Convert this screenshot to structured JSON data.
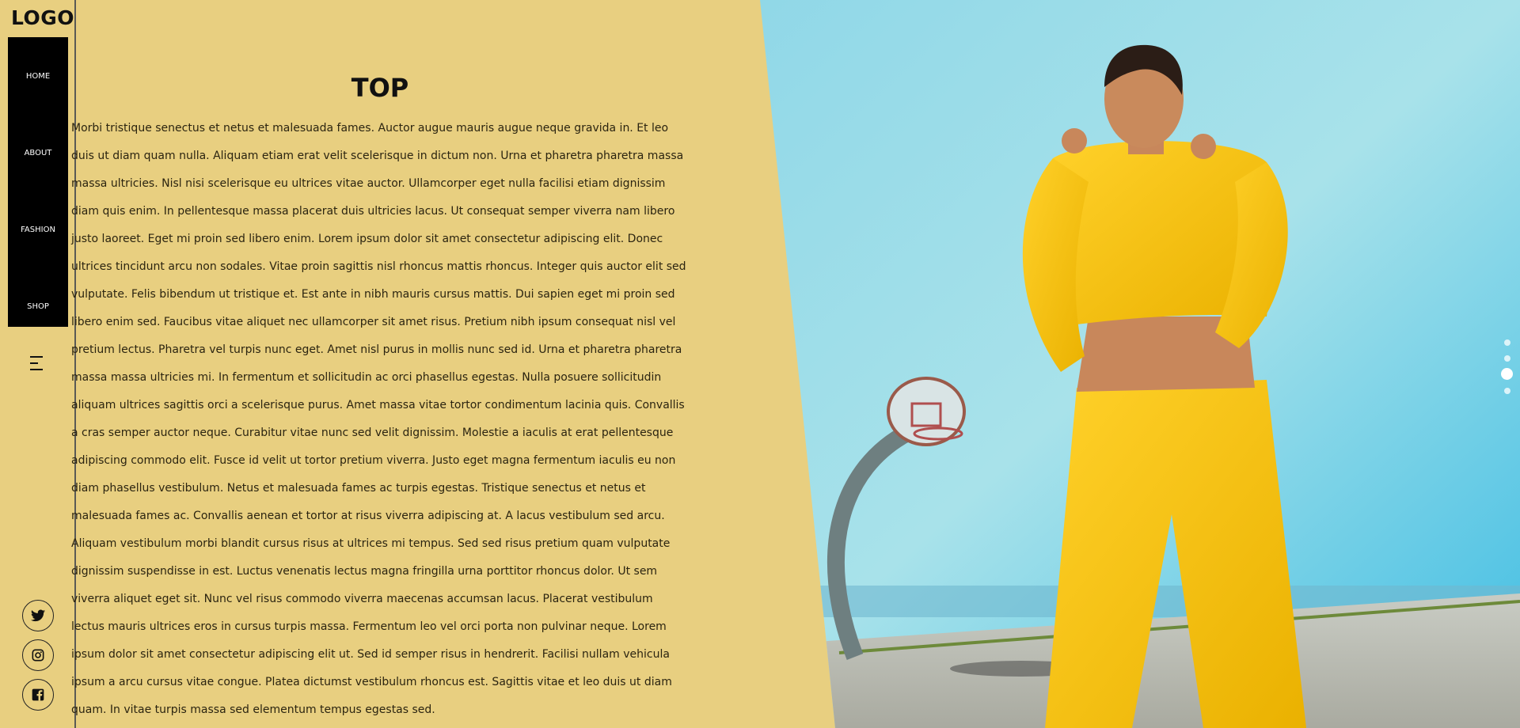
{
  "logo": "LOGO",
  "nav": {
    "items": [
      "HOME",
      "ABOUT",
      "FASHION",
      "SHOP"
    ]
  },
  "icons": {
    "menu": "hamburger-menu-icon",
    "twitter": "twitter-icon",
    "instagram": "instagram-icon",
    "facebook": "facebook-icon"
  },
  "main": {
    "title": "TOP",
    "paragraph": "Morbi tristique senectus et netus et malesuada fames. Auctor augue mauris augue neque gravida in. Et leo duis ut diam quam nulla. Aliquam etiam erat velit scelerisque in dictum non. Urna et pharetra pharetra massa massa ultricies. Nisl nisi scelerisque eu ultrices vitae auctor. Ullamcorper eget nulla facilisi etiam dignissim diam quis enim. In pellentesque massa placerat duis ultricies lacus. Ut consequat semper viverra nam libero justo laoreet. Eget mi proin sed libero enim. Lorem ipsum dolor sit amet consectetur adipiscing elit. Donec ultrices tincidunt arcu non sodales. Vitae proin sagittis nisl rhoncus mattis rhoncus. Integer quis auctor elit sed vulputate. Felis bibendum ut tristique et. Est ante in nibh mauris cursus mattis. Dui sapien eget mi proin sed libero enim sed. Faucibus vitae aliquet nec ullamcorper sit amet risus. Pretium nibh ipsum consequat nisl vel pretium lectus. Pharetra vel turpis nunc eget. Amet nisl purus in mollis nunc sed id. Urna et pharetra pharetra massa massa ultricies mi. In fermentum et sollicitudin ac orci phasellus egestas. Nulla posuere sollicitudin aliquam ultrices sagittis orci a scelerisque purus. Amet massa vitae tortor condimentum lacinia quis. Convallis a cras semper auctor neque. Curabitur vitae nunc sed velit dignissim. Molestie a iaculis at erat pellentesque adipiscing commodo elit. Fusce id velit ut tortor pretium viverra. Justo eget magna fermentum iaculis eu non diam phasellus vestibulum. Netus et malesuada fames ac turpis egestas. Tristique senectus et netus et malesuada fames ac. Convallis aenean et tortor at risus viverra adipiscing at. A lacus vestibulum sed arcu. Aliquam vestibulum morbi blandit cursus risus at ultrices mi tempus. Sed sed risus pretium quam vulputate dignissim suspendisse in est. Luctus venenatis lectus magna fringilla urna porttitor rhoncus dolor. Ut sem viverra aliquet eget sit. Nunc vel risus commodo viverra maecenas accumsan lacus. Placerat vestibulum lectus mauris ultrices eros in cursus turpis massa. Fermentum leo vel orci porta non pulvinar neque. Lorem ipsum dolor sit amet consectetur adipiscing elit ut. Sed id semper risus in hendrerit. Facilisi nullam vehicula ipsum a arcu cursus vitae congue. Platea dictumst vestibulum rhoncus est. Sagittis vitae et leo duis ut diam quam. In vitae turpis massa sed elementum tempus egestas sed."
  },
  "slider": {
    "total": 4,
    "active_index": 3
  },
  "colors": {
    "background": "#e8cf80",
    "nav_bg": "#000000",
    "sky": "#7fd0e6",
    "outfit": "#f5c21a"
  }
}
